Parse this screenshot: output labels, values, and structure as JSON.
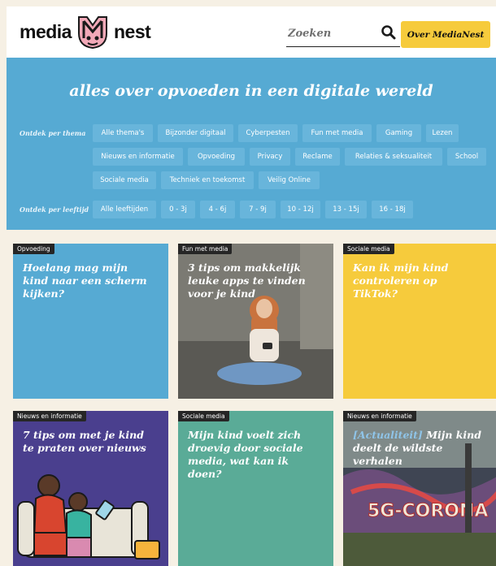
{
  "header": {
    "logo_left": "media",
    "logo_right": "nest",
    "search_placeholder": "Zoeken",
    "about_label": "Over MediaNest"
  },
  "hero": {
    "title": "alles over opvoeden in een digitale wereld",
    "theme_label": "Ontdek per thema",
    "age_label": "Ontdek per leeftijd",
    "themes": [
      "Alle thema's",
      "Bijzonder digitaal",
      "Cyberpesten",
      "Fun met media",
      "Gaming",
      "Lezen",
      "Nieuws en informatie",
      "Opvoeding",
      "Privacy",
      "Reclame",
      "Relaties & seksualiteit",
      "School",
      "Sociale media",
      "Techniek en toekomst",
      "Veilig Online"
    ],
    "ages": [
      "Alle leeftijden",
      "0 - 3j",
      "4 - 6j",
      "7 - 9j",
      "10 - 12j",
      "13 - 15j",
      "16 - 18j"
    ]
  },
  "cards": [
    {
      "tag": "Opvoeding",
      "title": "Hoelang mag mijn kind naar een scherm kijken?",
      "color": "#56aad3"
    },
    {
      "tag": "Fun met media",
      "title": "3 tips om makkelijk leuke apps te vinden voor je kind",
      "color": "#6e6e68"
    },
    {
      "tag": "Sociale media",
      "title": "Kan ik mijn kind controleren op TikTok?",
      "color": "#f6cb3c"
    },
    {
      "tag": "Nieuws en informatie",
      "title": "7 tips om met je kind te praten over nieuws",
      "color": "#4a3f8e"
    },
    {
      "tag": "Sociale media",
      "title": "Mijn kind voelt zich droevig door sociale media, wat kan ik doen?",
      "color": "#5aab97"
    },
    {
      "tag": "Nieuws en informatie",
      "title_prefix": "[Actualiteit]",
      "title": "Mijn kind deelt de wildste verhalen",
      "color": "#505a58",
      "mural_text": "5G-CORONA"
    }
  ]
}
